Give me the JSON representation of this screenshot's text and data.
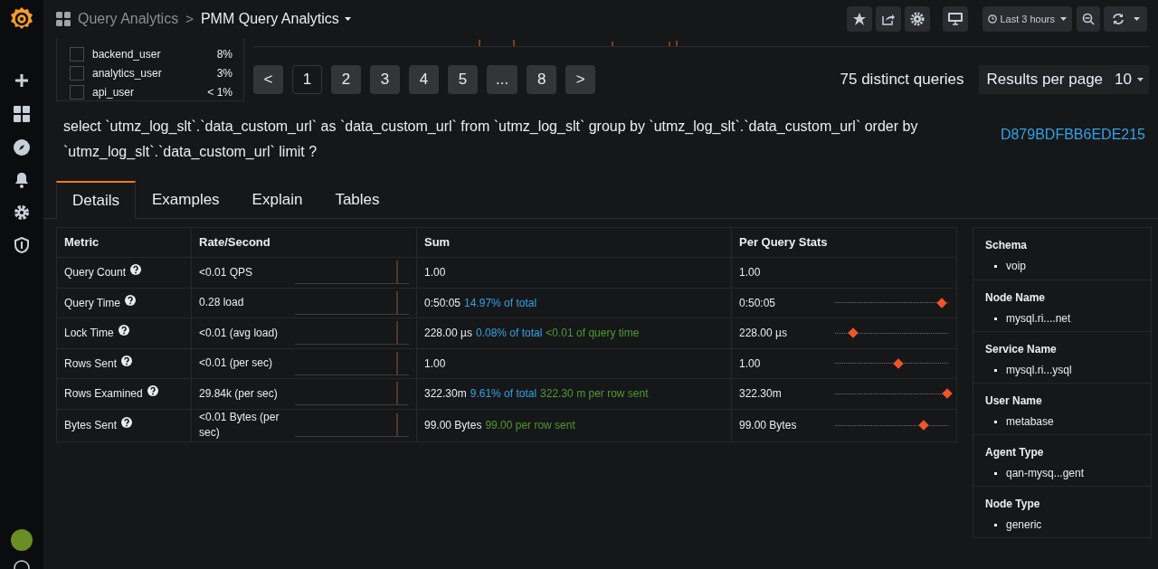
{
  "top_bar": {
    "breadcrumb": "Query Analytics",
    "separator": ">",
    "title": "PMM Query Analytics",
    "time_range": "Last 3 hours"
  },
  "filters": [
    {
      "label": "backend_user",
      "value": "8%",
      "checked": false
    },
    {
      "label": "analytics_user",
      "value": "3%",
      "checked": false
    },
    {
      "label": "api_user",
      "value": "< 1%",
      "checked": false
    }
  ],
  "pagination": {
    "prev": "<",
    "next": ">",
    "pages": [
      {
        "label": "1",
        "selected": true
      },
      {
        "label": "2",
        "selected": false
      },
      {
        "label": "3",
        "selected": false
      },
      {
        "label": "4",
        "selected": false
      },
      {
        "label": "5",
        "selected": false
      },
      {
        "label": "...",
        "selected": false
      },
      {
        "label": "8",
        "selected": false
      }
    ]
  },
  "distinct_queries": "75 distinct queries",
  "results_per_page": {
    "label": "Results per page",
    "value": "10"
  },
  "query": {
    "text": "select `utmz_log_slt`.`data_custom_url` as `data_custom_url` from `utmz_log_slt` group by `utmz_log_slt`.`data_custom_url` order by `utmz_log_slt`.`data_custom_url` limit ?",
    "id": "D879BDFBB6EDE215"
  },
  "tabs": [
    {
      "label": "Details",
      "selected": true
    },
    {
      "label": "Examples",
      "selected": false
    },
    {
      "label": "Explain",
      "selected": false
    },
    {
      "label": "Tables",
      "selected": false
    }
  ],
  "metrics_table": {
    "columns": [
      "Metric",
      "Rate/Second",
      "Sum",
      "Per Query Stats"
    ],
    "rows": [
      {
        "metric": "Query Count",
        "rate": "<0.01 QPS",
        "sum": "1.00",
        "per_query": "1.00"
      },
      {
        "metric": "Query Time",
        "rate": "0.28 load",
        "sum": "0:50:05",
        "sum_percent": "14.97% of total",
        "per_query": "0:50:05",
        "level": 0.94
      },
      {
        "metric": "Lock Time",
        "rate": "<0.01 (avg load)",
        "sum": "228.00 µs",
        "sum_percent": "0.08% of total",
        "sum_extra": "<0.01 of query time",
        "per_query": "228.00 µs",
        "level": 0.16
      },
      {
        "metric": "Rows Sent",
        "rate": "<0.01 (per sec)",
        "sum": "1.00",
        "per_query": "1.00",
        "level": 0.56
      },
      {
        "metric": "Rows Examined",
        "rate": "29.84k (per sec)",
        "sum": "322.30m",
        "sum_percent": "9.61% of total",
        "sum_extra": "322.30 m per row sent",
        "per_query": "322.30m",
        "level": 0.99
      },
      {
        "metric": "Bytes Sent",
        "rate": "<0.01 Bytes (per sec)",
        "sum": "99.00 Bytes",
        "sum_extra": "99.00 per row sent",
        "per_query": "99.00 Bytes",
        "level": 0.78
      }
    ]
  },
  "info_panel": [
    {
      "title": "Schema",
      "value": "voip"
    },
    {
      "title": "Node Name",
      "value": "mysql.ri....net"
    },
    {
      "title": "Service Name",
      "value": "mysql.ri...ysql"
    },
    {
      "title": "User Name",
      "value": "metabase"
    },
    {
      "title": "Agent Type",
      "value": "qan-mysq...gent"
    },
    {
      "title": "Node Type",
      "value": "generic"
    }
  ]
}
